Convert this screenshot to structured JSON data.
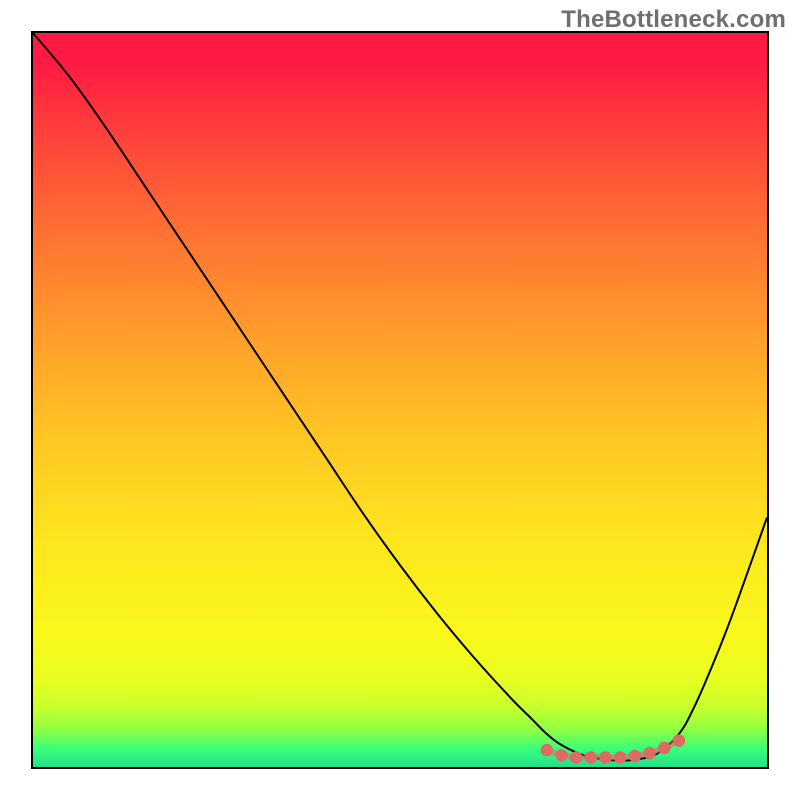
{
  "watermark": "TheBottleneck.com",
  "chart_data": {
    "type": "line",
    "title": "",
    "xlabel": "",
    "ylabel": "",
    "xlim": [
      0,
      100
    ],
    "ylim": [
      0,
      100
    ],
    "grid": false,
    "series": [
      {
        "name": "main-curve",
        "color": "#000000",
        "x": [
          0,
          5,
          10,
          15,
          20,
          25,
          30,
          35,
          40,
          45,
          50,
          55,
          60,
          65,
          68,
          70,
          72,
          75,
          78,
          80,
          82,
          85,
          88,
          90,
          92,
          95,
          100
        ],
        "y": [
          100,
          94,
          87,
          79.5,
          72,
          64.5,
          57,
          49.5,
          42,
          34.5,
          27.5,
          21,
          15,
          9.5,
          6.5,
          4.5,
          3,
          1.6,
          1.0,
          0.9,
          1.0,
          1.8,
          4.5,
          8,
          12.5,
          20,
          34
        ]
      },
      {
        "name": "highlight-dots",
        "color": "#dd6a63",
        "x": [
          70,
          72,
          74,
          76,
          78,
          80,
          82,
          84,
          86,
          88
        ],
        "y": [
          2.3,
          1.6,
          1.3,
          1.3,
          1.3,
          1.3,
          1.5,
          1.9,
          2.6,
          3.6
        ]
      }
    ]
  }
}
